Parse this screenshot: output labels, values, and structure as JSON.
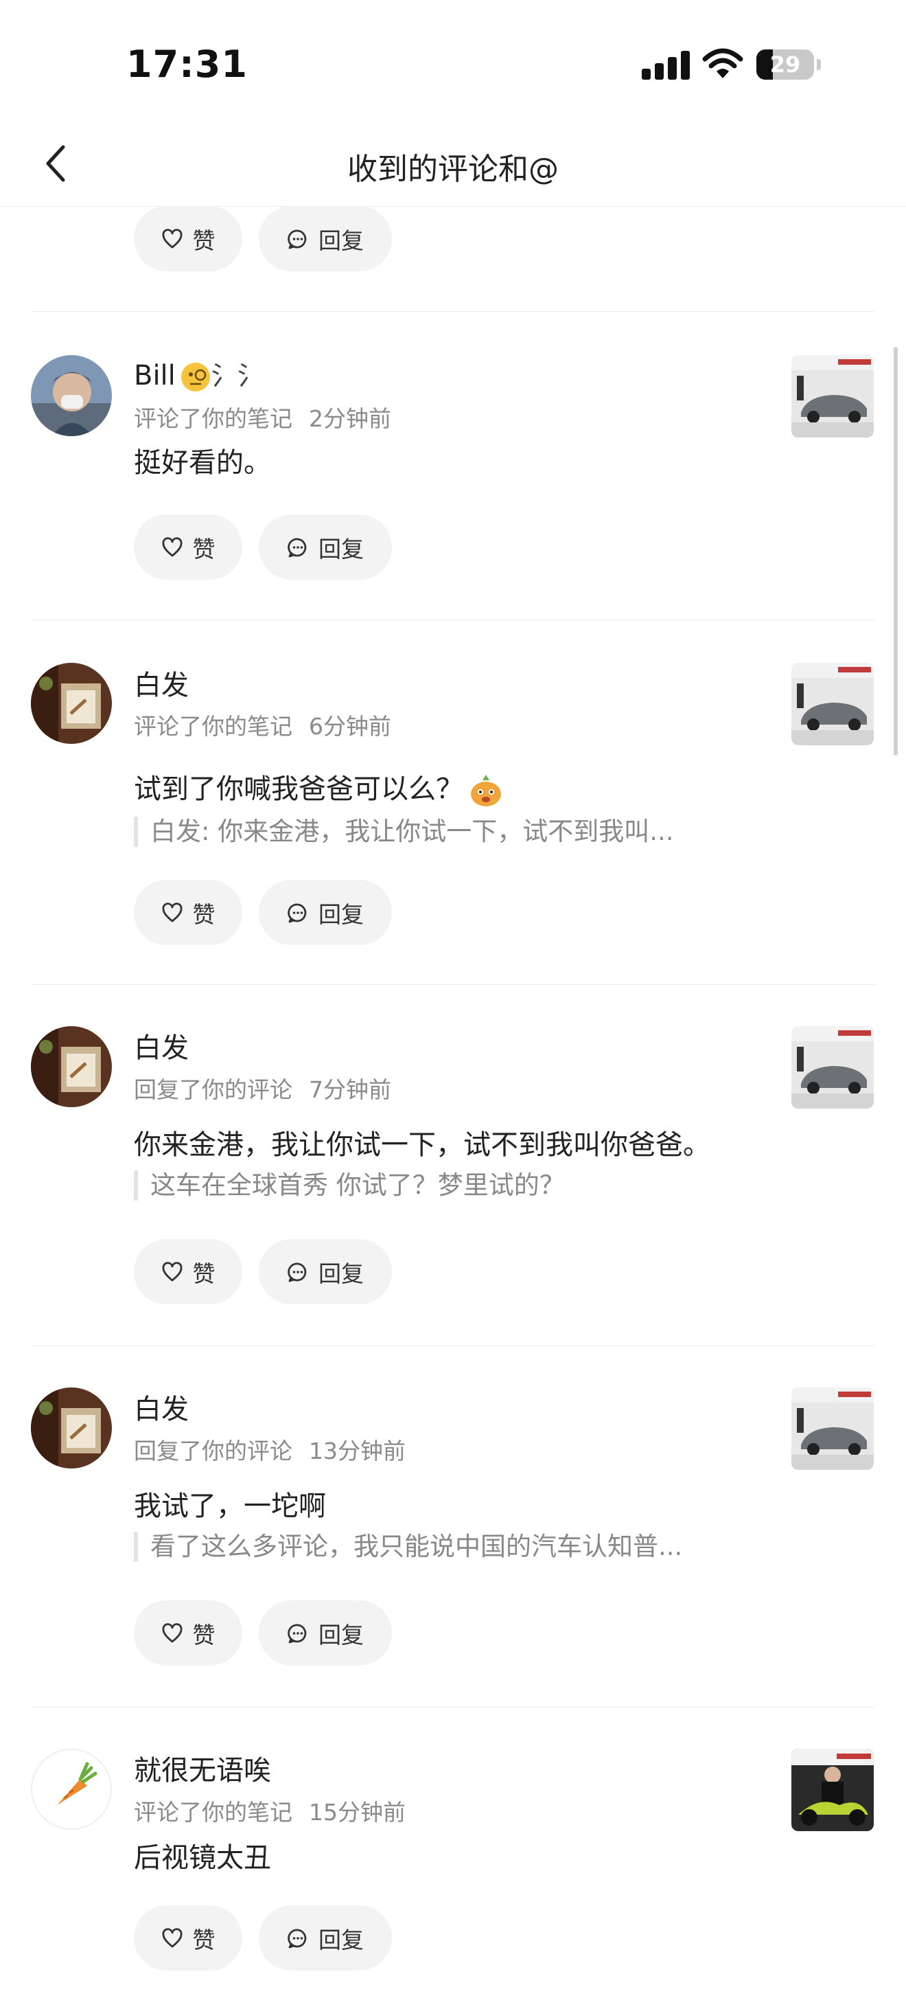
{
  "status_bar": {
    "time": "17:31",
    "battery": "29",
    "battery_level": 0.29
  },
  "nav": {
    "title": "收到的评论和@"
  },
  "actions": {
    "like_label": "赞",
    "reply_label": "回复"
  },
  "comments": [
    {
      "name": "Bill",
      "name_extra": "氵氵",
      "action": "评论了你的笔记",
      "time": "2分钟前",
      "text": "挺好看的。"
    },
    {
      "name": "白发",
      "action": "评论了你的笔记",
      "time": "6分钟前",
      "text": "试到了你喊我爸爸可以么？",
      "quote": "白发: 你来金港，我让你试一下，试不到我叫..."
    },
    {
      "name": "白发",
      "action": "回复了你的评论",
      "time": "7分钟前",
      "text": "你来金港，我让你试一下，试不到我叫你爸爸。",
      "quote": "这车在全球首秀 你试了？梦里试的？"
    },
    {
      "name": "白发",
      "action": "回复了你的评论",
      "time": "13分钟前",
      "text": "我试了，一坨啊",
      "quote": "看了这么多评论，我只能说中国的汽车认知普..."
    },
    {
      "name": "就很无语唉",
      "action": "评论了你的笔记",
      "time": "15分钟前",
      "text": "后视镜太丑"
    }
  ]
}
